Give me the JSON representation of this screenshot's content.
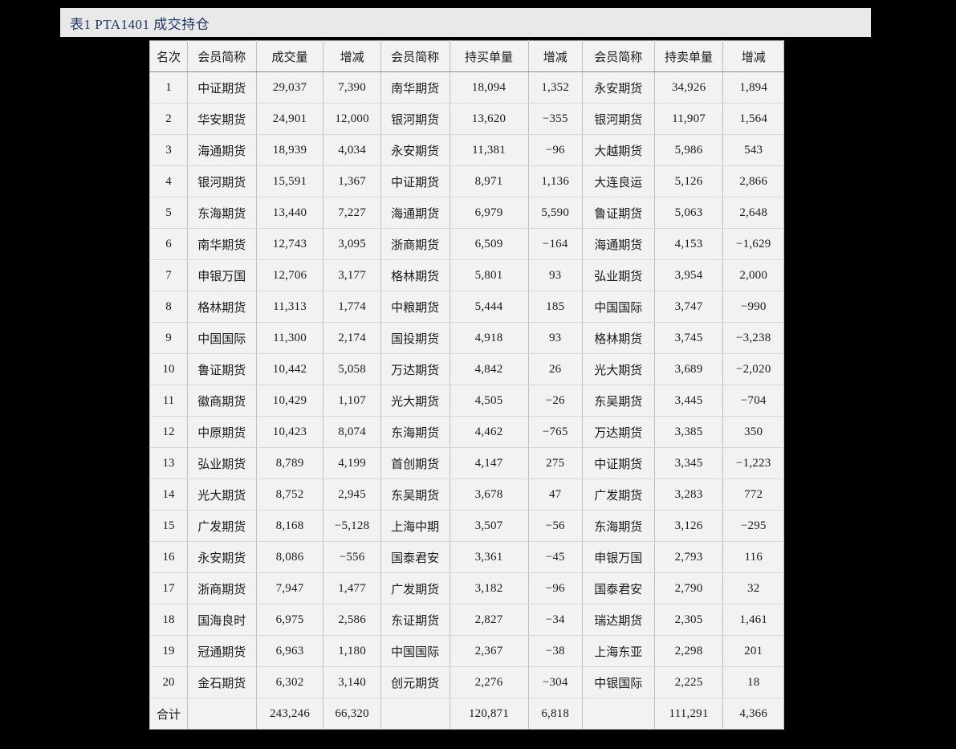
{
  "title": {
    "text": "表1 PTA1401 成交持仓"
  },
  "table": {
    "headers": [
      "名次",
      "会员简称",
      "成交量",
      "增减",
      "会员简称",
      "持买单量",
      "增减",
      "会员简称",
      "持卖单量",
      "增减"
    ],
    "rows": [
      [
        "1",
        "中证期货",
        "29,037",
        "7,390",
        "南华期货",
        "18,094",
        "1,352",
        "永安期货",
        "34,926",
        "1,894"
      ],
      [
        "2",
        "华安期货",
        "24,901",
        "12,000",
        "银河期货",
        "13,620",
        "−355",
        "银河期货",
        "11,907",
        "1,564"
      ],
      [
        "3",
        "海通期货",
        "18,939",
        "4,034",
        "永安期货",
        "11,381",
        "−96",
        "大越期货",
        "5,986",
        "543"
      ],
      [
        "4",
        "银河期货",
        "15,591",
        "1,367",
        "中证期货",
        "8,971",
        "1,136",
        "大连良运",
        "5,126",
        "2,866"
      ],
      [
        "5",
        "东海期货",
        "13,440",
        "7,227",
        "海通期货",
        "6,979",
        "5,590",
        "鲁证期货",
        "5,063",
        "2,648"
      ],
      [
        "6",
        "南华期货",
        "12,743",
        "3,095",
        "浙商期货",
        "6,509",
        "−164",
        "海通期货",
        "4,153",
        "−1,629"
      ],
      [
        "7",
        "申银万国",
        "12,706",
        "3,177",
        "格林期货",
        "5,801",
        "93",
        "弘业期货",
        "3,954",
        "2,000"
      ],
      [
        "8",
        "格林期货",
        "11,313",
        "1,774",
        "中粮期货",
        "5,444",
        "185",
        "中国国际",
        "3,747",
        "−990"
      ],
      [
        "9",
        "中国国际",
        "11,300",
        "2,174",
        "国投期货",
        "4,918",
        "93",
        "格林期货",
        "3,745",
        "−3,238"
      ],
      [
        "10",
        "鲁证期货",
        "10,442",
        "5,058",
        "万达期货",
        "4,842",
        "26",
        "光大期货",
        "3,689",
        "−2,020"
      ],
      [
        "11",
        "徽商期货",
        "10,429",
        "1,107",
        "光大期货",
        "4,505",
        "−26",
        "东吴期货",
        "3,445",
        "−704"
      ],
      [
        "12",
        "中原期货",
        "10,423",
        "8,074",
        "东海期货",
        "4,462",
        "−765",
        "万达期货",
        "3,385",
        "350"
      ],
      [
        "13",
        "弘业期货",
        "8,789",
        "4,199",
        "首创期货",
        "4,147",
        "275",
        "中证期货",
        "3,345",
        "−1,223"
      ],
      [
        "14",
        "光大期货",
        "8,752",
        "2,945",
        "东吴期货",
        "3,678",
        "47",
        "广发期货",
        "3,283",
        "772"
      ],
      [
        "15",
        "广发期货",
        "8,168",
        "−5,128",
        "上海中期",
        "3,507",
        "−56",
        "东海期货",
        "3,126",
        "−295"
      ],
      [
        "16",
        "永安期货",
        "8,086",
        "−556",
        "国泰君安",
        "3,361",
        "−45",
        "申银万国",
        "2,793",
        "116"
      ],
      [
        "17",
        "浙商期货",
        "7,947",
        "1,477",
        "广发期货",
        "3,182",
        "−96",
        "国泰君安",
        "2,790",
        "32"
      ],
      [
        "18",
        "国海良时",
        "6,975",
        "2,586",
        "东证期货",
        "2,827",
        "−34",
        "瑞达期货",
        "2,305",
        "1,461"
      ],
      [
        "19",
        "冠通期货",
        "6,963",
        "1,180",
        "中国国际",
        "2,367",
        "−38",
        "上海东亚",
        "2,298",
        "201"
      ],
      [
        "20",
        "金石期货",
        "6,302",
        "3,140",
        "创元期货",
        "2,276",
        "−304",
        "中银国际",
        "2,225",
        "18"
      ]
    ],
    "total_row": [
      "合计",
      "",
      "243,246",
      "66,320",
      "",
      "120,871",
      "6,818",
      "",
      "111,291",
      "4,366"
    ]
  },
  "colors": {
    "title_text": "#1f3864",
    "title_bar_bg": "#e9e9e9",
    "cell_bg": "#f2f2f2",
    "page_bg": "#000000"
  }
}
